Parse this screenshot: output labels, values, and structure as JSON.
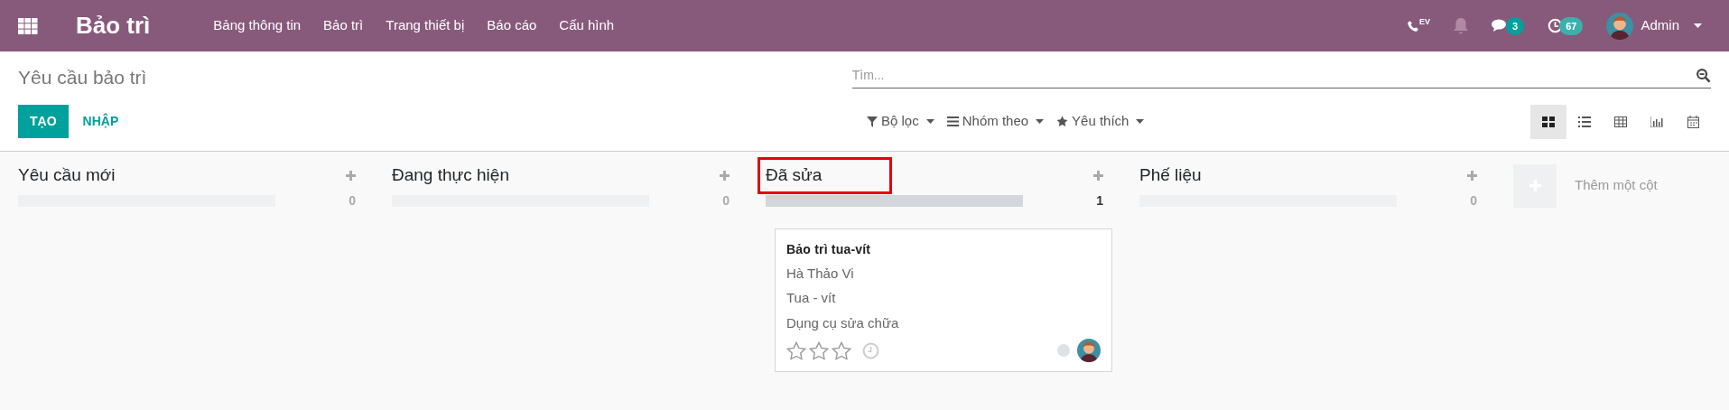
{
  "navbar": {
    "app_title": "Bảo trì",
    "menu": [
      "Bảng thông tin",
      "Bảo trì",
      "Trang thiết bị",
      "Báo cáo",
      "Cấu hình"
    ],
    "phone_label": "EV",
    "messages_count": "3",
    "activities_count": "67",
    "user": "Admin"
  },
  "control_panel": {
    "breadcrumb": "Yêu cầu bảo trì",
    "buttons": [
      {
        "label": "TẠO",
        "kind": "primary"
      },
      {
        "label": "NHẬP",
        "kind": "link"
      }
    ],
    "search": {
      "placeholder": "Tìm..."
    },
    "filters": [
      {
        "label": "Bộ lọc",
        "kind": "filter"
      },
      {
        "label": "Nhóm theo",
        "kind": "group"
      },
      {
        "label": "Yêu thích",
        "kind": "favorite"
      }
    ],
    "views": [
      {
        "kind": "kanban",
        "selected": true
      },
      {
        "kind": "list",
        "selected": false
      },
      {
        "kind": "pivot",
        "selected": false
      },
      {
        "kind": "graph",
        "selected": false
      },
      {
        "kind": "calendar",
        "selected": false
      }
    ]
  },
  "columns": [
    {
      "title": "Yêu cầu mới",
      "count": "0",
      "filled": false,
      "highlighted": false
    },
    {
      "title": "Đang thực hiện",
      "count": "0",
      "filled": false,
      "highlighted": false
    },
    {
      "title": "Đã sửa",
      "count": "1",
      "filled": true,
      "highlighted": true,
      "cards": [
        {
          "title": "Bảo trì tua-vít",
          "lines": [
            "Hà Thảo Vi",
            "Tua - vít",
            "Dụng cụ sửa chữa"
          ],
          "stars": 0,
          "color": "#dee2e6"
        }
      ]
    },
    {
      "title": "Phế liệu",
      "count": "0",
      "filled": false,
      "highlighted": false
    }
  ],
  "add_column": "Thêm một cột"
}
